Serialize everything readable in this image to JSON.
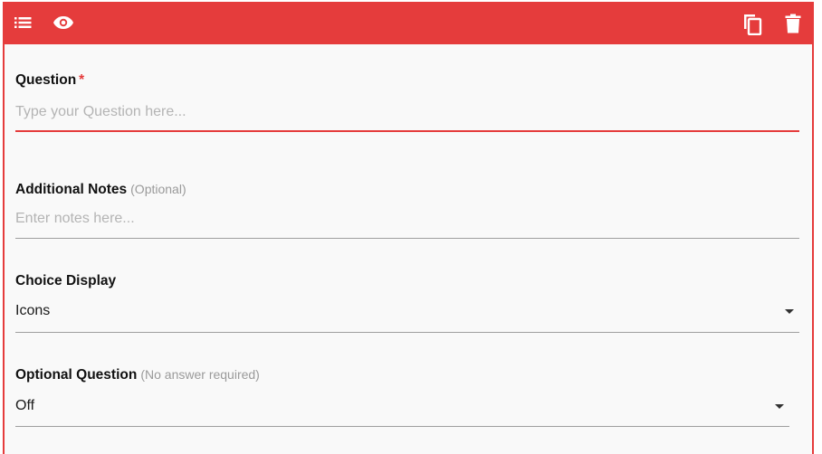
{
  "toolbar": {
    "background_color": "#e53c3c",
    "left_icons": [
      "list-icon",
      "eye-icon"
    ],
    "right_icons": [
      "copy-icon",
      "trash-icon"
    ]
  },
  "question": {
    "label": "Question",
    "required_mark": "*",
    "placeholder": "Type your Question here...",
    "value": ""
  },
  "notes": {
    "label": "Additional Notes",
    "hint": "(Optional)",
    "placeholder": "Enter notes here...",
    "value": ""
  },
  "choice_display": {
    "label": "Choice Display",
    "selected": "Icons"
  },
  "optional_question": {
    "label": "Optional Question",
    "hint": "(No answer required)",
    "selected": "Off"
  }
}
